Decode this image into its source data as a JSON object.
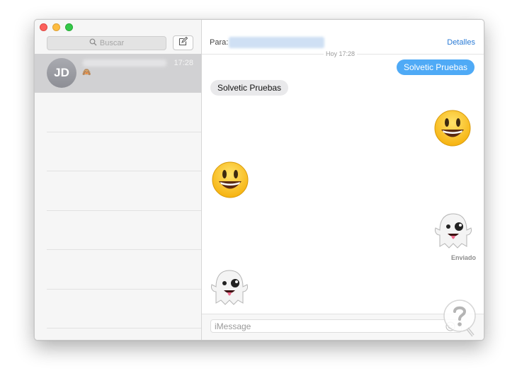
{
  "sidebar": {
    "search_placeholder": "Buscar",
    "conversation": {
      "initials": "JD",
      "time": "17:28",
      "preview": "🙈"
    }
  },
  "chat": {
    "header": {
      "to_label": "Para:",
      "details_label": "Detalles"
    },
    "day_label": "Hoy 17:28",
    "messages": {
      "out_text": "Solvetic Pruebas",
      "in_text": "Solvetic Pruebas",
      "smile_out": "😃",
      "smile_in": "😃",
      "ghost_out": "👻",
      "ghost_in": "👻"
    },
    "delivered_label": "Enviado",
    "input_placeholder": "iMessage"
  },
  "colors": {
    "accent": "#2a7bd6",
    "outgoing_bubble": "#4faaf6",
    "incoming_bubble": "#e9e9eb",
    "selected_row": "#d1d1d3"
  }
}
